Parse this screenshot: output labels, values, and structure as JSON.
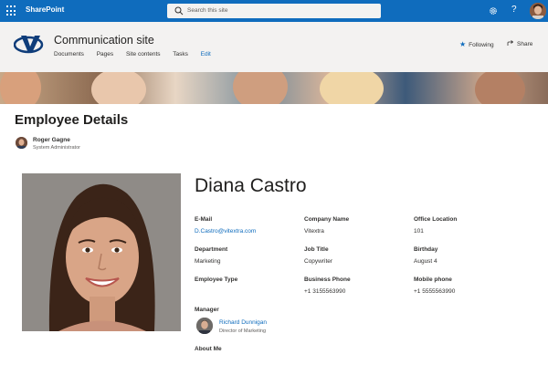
{
  "suitebar": {
    "brand": "SharePoint",
    "search_placeholder": "Search this site",
    "help": "?"
  },
  "site": {
    "title": "Communication site",
    "nav": [
      {
        "label": "Documents"
      },
      {
        "label": "Pages"
      },
      {
        "label": "Site contents"
      },
      {
        "label": "Tasks"
      },
      {
        "label": "Edit"
      }
    ],
    "follow_label": "Following",
    "share_label": "Share"
  },
  "page": {
    "title": "Employee Details",
    "author": {
      "name": "Roger Gagne",
      "role": "System Administrator"
    }
  },
  "employee": {
    "name": "Diana Castro",
    "fields": {
      "email": {
        "label": "E-Mail",
        "value": "D.Castro@vitextra.com"
      },
      "company": {
        "label": "Company Name",
        "value": "Vitextra"
      },
      "office": {
        "label": "Office Location",
        "value": "101"
      },
      "department": {
        "label": "Department",
        "value": "Marketing"
      },
      "job_title": {
        "label": "Job Title",
        "value": "Copywriter"
      },
      "birthday": {
        "label": "Birthday",
        "value": "August 4"
      },
      "employee_type": {
        "label": "Employee Type",
        "value": ""
      },
      "business_phone": {
        "label": "Business Phone",
        "value": "+1 3155563990"
      },
      "mobile_phone": {
        "label": "Mobile phone",
        "value": "+1 5555563990"
      }
    },
    "manager": {
      "label": "Manager",
      "name": "Richard Dunnigan",
      "role": "Director of Marketing"
    },
    "about_label": "About Me"
  },
  "colors": {
    "accent": "#0f6cbd",
    "header_bg": "#f3f2f1"
  },
  "icons": [
    "app-launcher-icon",
    "search-icon",
    "settings-gear-icon",
    "help-icon",
    "star-icon",
    "share-icon"
  ]
}
